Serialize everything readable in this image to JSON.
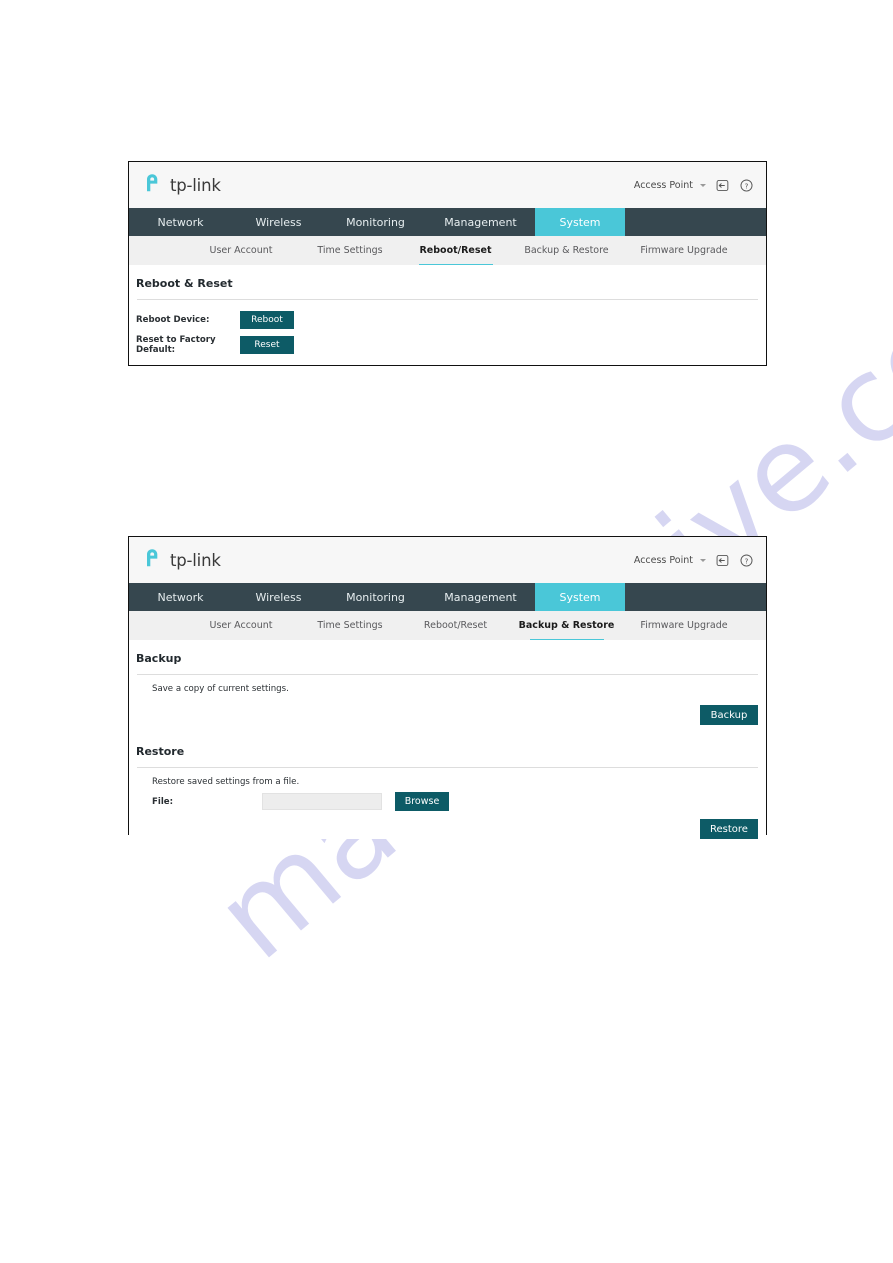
{
  "watermark": {
    "text": "manualshive.com"
  },
  "panels": [
    {
      "id": "reboot-reset",
      "brand": {
        "logo_text": "tp-link",
        "logo_icon": "tplink-logo-icon",
        "mode_label": "Access Point",
        "caret_icon": "chevron-down-icon",
        "logout_icon": "logout-icon",
        "help_icon": "help-circle-icon"
      },
      "mainnav": [
        {
          "label": "Network",
          "active": false
        },
        {
          "label": "Wireless",
          "active": false
        },
        {
          "label": "Monitoring",
          "active": false
        },
        {
          "label": "Management",
          "active": false
        },
        {
          "label": "System",
          "active": true
        }
      ],
      "subnav": [
        {
          "label": "User Account",
          "active": false
        },
        {
          "label": "Time Settings",
          "active": false
        },
        {
          "label": "Reboot/Reset",
          "active": true
        },
        {
          "label": "Backup & Restore",
          "active": false
        },
        {
          "label": "Firmware Upgrade",
          "active": false
        }
      ],
      "section_title": "Reboot & Reset",
      "rows": [
        {
          "label": "Reboot Device:",
          "button": "Reboot"
        },
        {
          "label": "Reset to Factory Default:",
          "button": "Reset"
        }
      ]
    },
    {
      "id": "backup-restore",
      "brand": {
        "logo_text": "tp-link",
        "logo_icon": "tplink-logo-icon",
        "mode_label": "Access Point",
        "caret_icon": "chevron-down-icon",
        "logout_icon": "logout-icon",
        "help_icon": "help-circle-icon"
      },
      "mainnav": [
        {
          "label": "Network",
          "active": false
        },
        {
          "label": "Wireless",
          "active": false
        },
        {
          "label": "Monitoring",
          "active": false
        },
        {
          "label": "Management",
          "active": false
        },
        {
          "label": "System",
          "active": true
        }
      ],
      "subnav": [
        {
          "label": "User Account",
          "active": false
        },
        {
          "label": "Time Settings",
          "active": false
        },
        {
          "label": "Reboot/Reset",
          "active": false
        },
        {
          "label": "Backup & Restore",
          "active": true
        },
        {
          "label": "Firmware Upgrade",
          "active": false
        }
      ],
      "backup": {
        "title": "Backup",
        "description": "Save a copy of current settings.",
        "button": "Backup"
      },
      "restore": {
        "title": "Restore",
        "description": "Restore saved settings from a file.",
        "file_label": "File:",
        "file_value": "",
        "browse_button": "Browse",
        "button": "Restore"
      }
    }
  ],
  "colors": {
    "nav_bg": "#36474f",
    "accent_cyan": "#4ac7d8",
    "button_teal": "#0d5b66",
    "brand_bg": "#f7f7f7",
    "subnav_bg": "#f0f0f0",
    "watermark": "#c9c9ee"
  }
}
